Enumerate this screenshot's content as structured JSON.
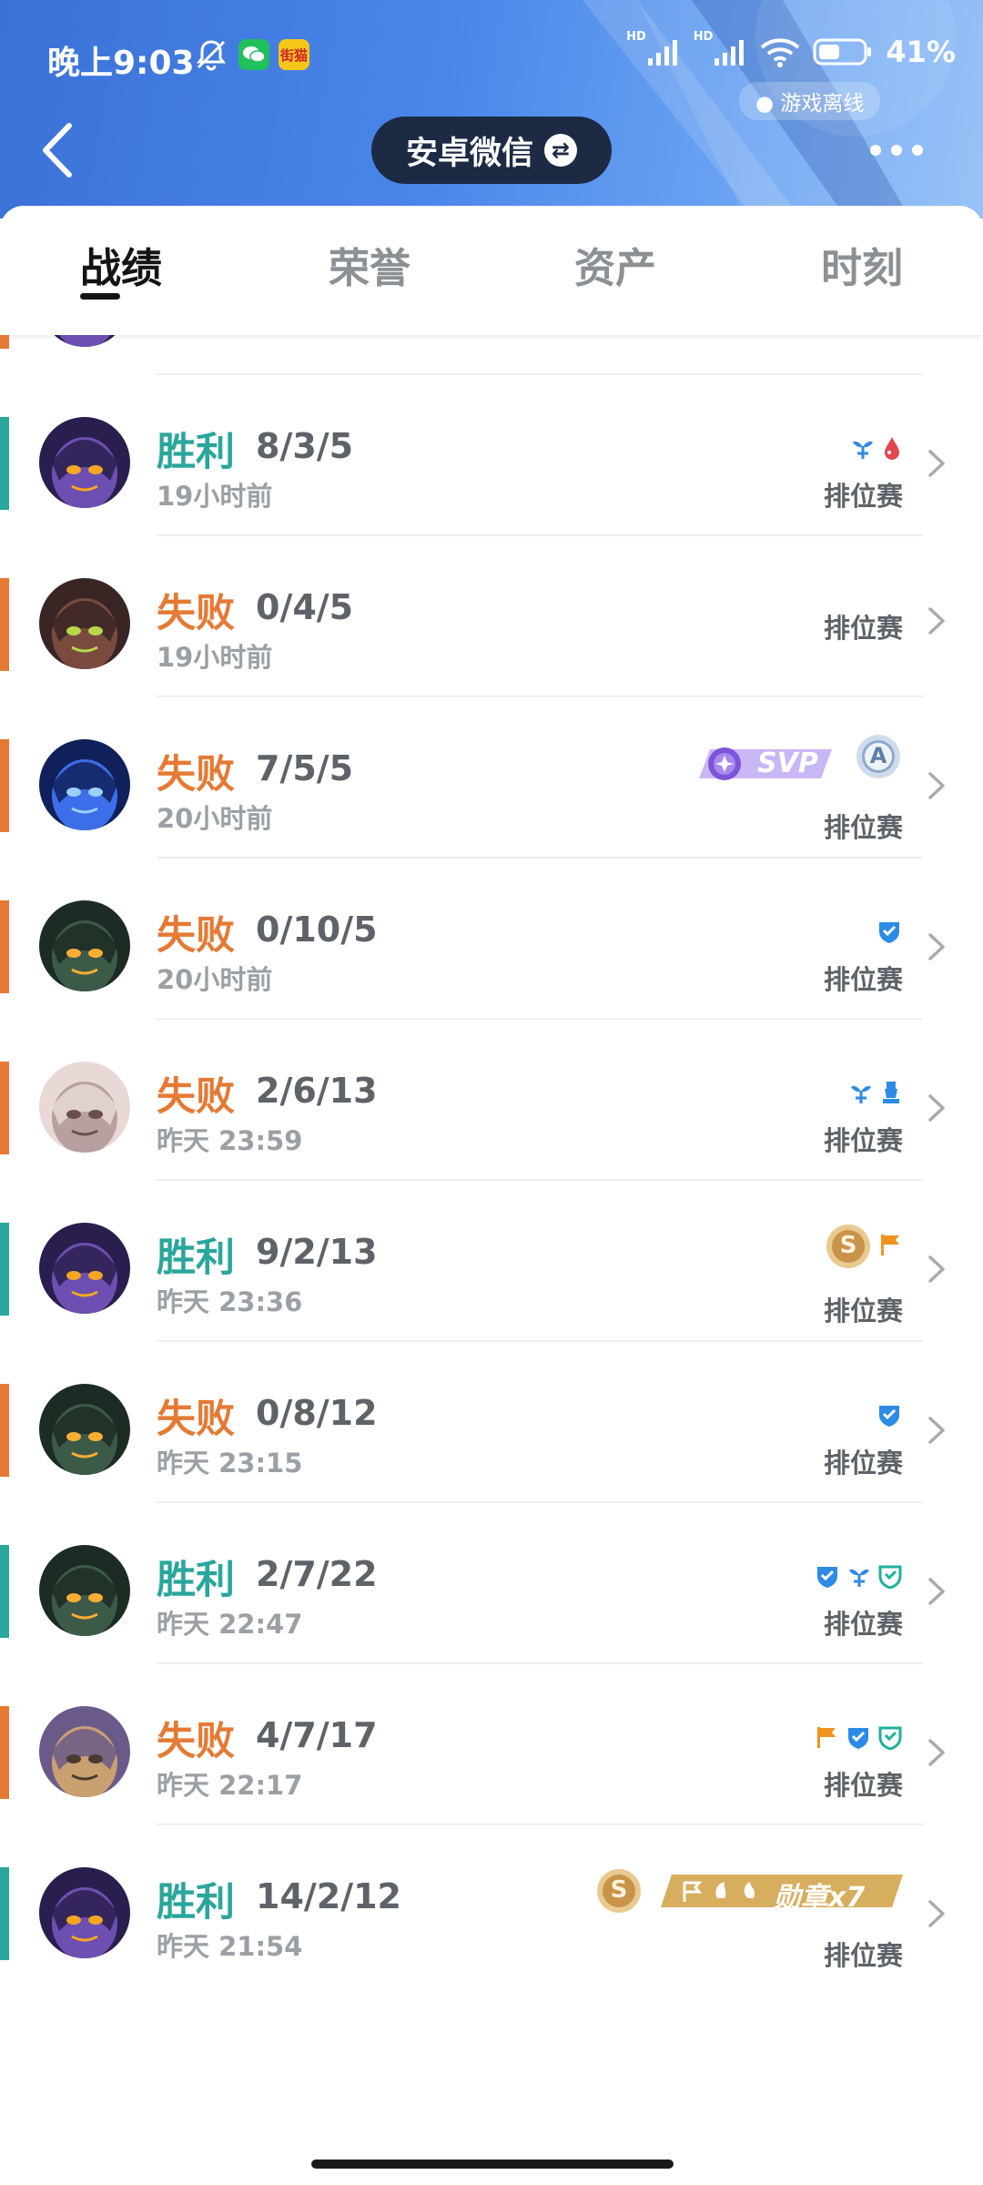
{
  "status_bar": {
    "time": "晚上9:03",
    "battery": "41%",
    "network_1": "HD",
    "network_2": "HD",
    "app_icon_2_label": "街猫"
  },
  "header": {
    "account": "安卓微信",
    "swap_symbol": "⇄",
    "game_status": "● 游戏离线"
  },
  "colors": {
    "win": "#2aa69b",
    "loss": "#e57a34",
    "header_blue": "#4a86ea",
    "badge_blue": "#2d8be6",
    "badge_red": "#e2484e",
    "badge_orange": "#f19220",
    "badge_teal": "#1fb29c"
  },
  "tabs": [
    "战绩",
    "荣誉",
    "资产",
    "时刻"
  ],
  "matches": [
    {
      "result": "胜利",
      "kda": "8/3/5",
      "ago": "19小时前",
      "mode": "排位赛",
      "avatar": "purple-hooded-hero",
      "badges": [
        "sprout-icon",
        "blood-drop-icon"
      ]
    },
    {
      "result": "失败",
      "kda": "0/4/5",
      "ago": "19小时前",
      "mode": "排位赛",
      "avatar": "dark-armored-hero",
      "badges": []
    },
    {
      "result": "失败",
      "kda": "7/5/5",
      "ago": "20小时前",
      "mode": "排位赛",
      "avatar": "blue-robot-hero",
      "badges": [
        "svp-badge",
        "grade-a-badge"
      ],
      "svp_label": "SVP",
      "grade_label": "A"
    },
    {
      "result": "失败",
      "kda": "0/10/5",
      "ago": "20小时前",
      "mode": "排位赛",
      "avatar": "green-hooded-hero",
      "badges": [
        "shield-icon"
      ]
    },
    {
      "result": "失败",
      "kda": "2/6/13",
      "ago": "昨天 23:59",
      "mode": "排位赛",
      "avatar": "pale-haired-hero",
      "badges": [
        "sprout-icon",
        "tower-icon"
      ]
    },
    {
      "result": "胜利",
      "kda": "9/2/13",
      "ago": "昨天 23:36",
      "mode": "排位赛",
      "avatar": "purple-hooded-hero",
      "badges": [
        "s-medal-badge",
        "flag-icon"
      ],
      "medal_label": "S"
    },
    {
      "result": "失败",
      "kda": "0/8/12",
      "ago": "昨天 23:15",
      "mode": "排位赛",
      "avatar": "green-hooded-hero",
      "badges": [
        "shield-icon"
      ]
    },
    {
      "result": "胜利",
      "kda": "2/7/22",
      "ago": "昨天 22:47",
      "mode": "排位赛",
      "avatar": "green-hooded-hero",
      "badges": [
        "shield-icon",
        "sprout-icon",
        "guard-icon"
      ]
    },
    {
      "result": "失败",
      "kda": "4/7/17",
      "ago": "昨天 22:17",
      "mode": "排位赛",
      "avatar": "hat-wearing-hero",
      "badges": [
        "flag-icon",
        "shield-icon",
        "guard-icon"
      ]
    },
    {
      "result": "胜利",
      "kda": "14/2/12",
      "ago": "昨天 21:54",
      "mode": "排位赛",
      "avatar": "purple-hooded-hero",
      "badges": [
        "s-medal-badge",
        "medal-count-banner"
      ],
      "medal_label": "S",
      "medal_banner": "勋章x7"
    }
  ]
}
